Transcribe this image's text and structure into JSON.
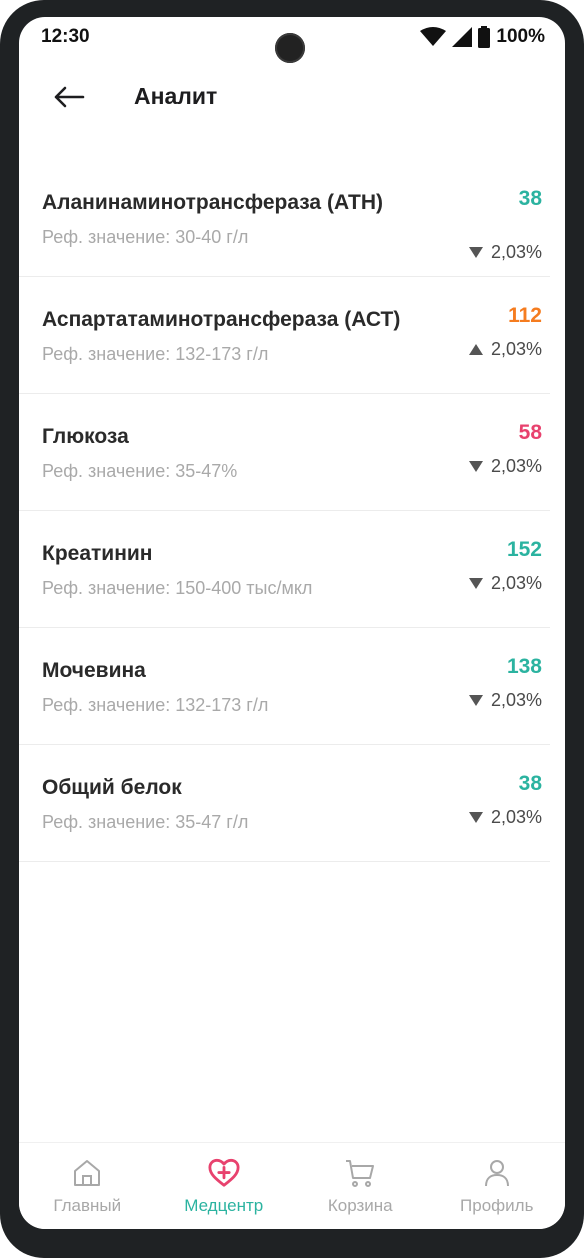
{
  "status_bar": {
    "time": "12:30",
    "battery": "100%"
  },
  "header": {
    "title": "Аналит",
    "back_icon": "arrow-left-icon"
  },
  "colors": {
    "teal": "#2bb3a0",
    "orange": "#f57c1f",
    "pink": "#e8426e",
    "active_nav": "#2bb3a0"
  },
  "analytes": [
    {
      "name": "Аланинаминотрансфераза (АТН)",
      "ref": "Реф. значение: 30-40 г/л",
      "value": "38",
      "value_color": "#2bb3a0",
      "trend": "down",
      "change": "2,03%"
    },
    {
      "name": "Аспартатаминотрансфераза (АСТ)",
      "ref": "Реф. значение: 132-173 г/л",
      "value": "112",
      "value_color": "#f57c1f",
      "trend": "up",
      "change": "2,03%"
    },
    {
      "name": "Глюкоза",
      "ref": "Реф. значение: 35-47%",
      "value": "58",
      "value_color": "#e8426e",
      "trend": "down",
      "change": "2,03%"
    },
    {
      "name": "Креатинин",
      "ref": "Реф. значение: 150-400 тыс/мкл",
      "value": "152",
      "value_color": "#2bb3a0",
      "trend": "down",
      "change": "2,03%"
    },
    {
      "name": "Мочевина",
      "ref": "Реф. значение: 132-173 г/л",
      "value": "138",
      "value_color": "#2bb3a0",
      "trend": "down",
      "change": "2,03%"
    },
    {
      "name": "Общий белок",
      "ref": "Реф. значение: 35-47 г/л",
      "value": "38",
      "value_color": "#2bb3a0",
      "trend": "down",
      "change": "2,03%"
    }
  ],
  "bottom_nav": [
    {
      "label": "Главный",
      "icon": "home-icon",
      "active": false
    },
    {
      "label": "Медцентр",
      "icon": "heart-plus-icon",
      "active": true
    },
    {
      "label": "Корзина",
      "icon": "cart-icon",
      "active": false
    },
    {
      "label": "Профиль",
      "icon": "profile-icon",
      "active": false
    }
  ]
}
